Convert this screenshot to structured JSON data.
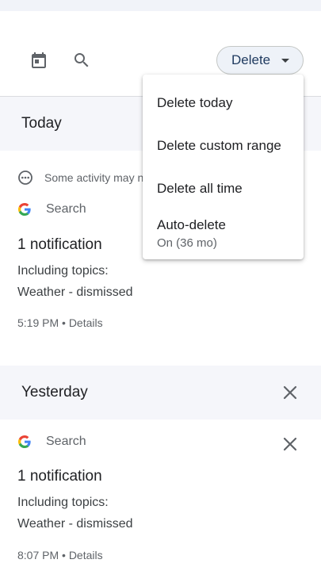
{
  "toolbar": {
    "calendar_icon": "calendar-icon",
    "search_icon": "search-icon",
    "delete_label": "Delete"
  },
  "menu": {
    "items": [
      {
        "label": "Delete today"
      },
      {
        "label": "Delete custom range"
      },
      {
        "label": "Delete all time"
      },
      {
        "label": "Auto-delete",
        "sublabel": "On (36 mo)"
      }
    ]
  },
  "sections": [
    {
      "header": "Today",
      "info_text": "Some activity may n",
      "card": {
        "source": "Search",
        "title": "1 notification",
        "line1": "Including topics:",
        "line2": "Weather - dismissed",
        "meta": "5:19 PM • Details"
      }
    },
    {
      "header": "Yesterday",
      "card": {
        "source": "Search",
        "title": "1 notification",
        "line1": "Including topics:",
        "line2": "Weather - dismissed",
        "meta": "8:07 PM • Details"
      }
    }
  ],
  "colors": {
    "accent": "#1f3a5f",
    "header_bg": "#f5f6fa",
    "google_blue": "#4285F4",
    "google_red": "#EA4335",
    "google_yellow": "#FBBC05",
    "google_green": "#34A853"
  }
}
